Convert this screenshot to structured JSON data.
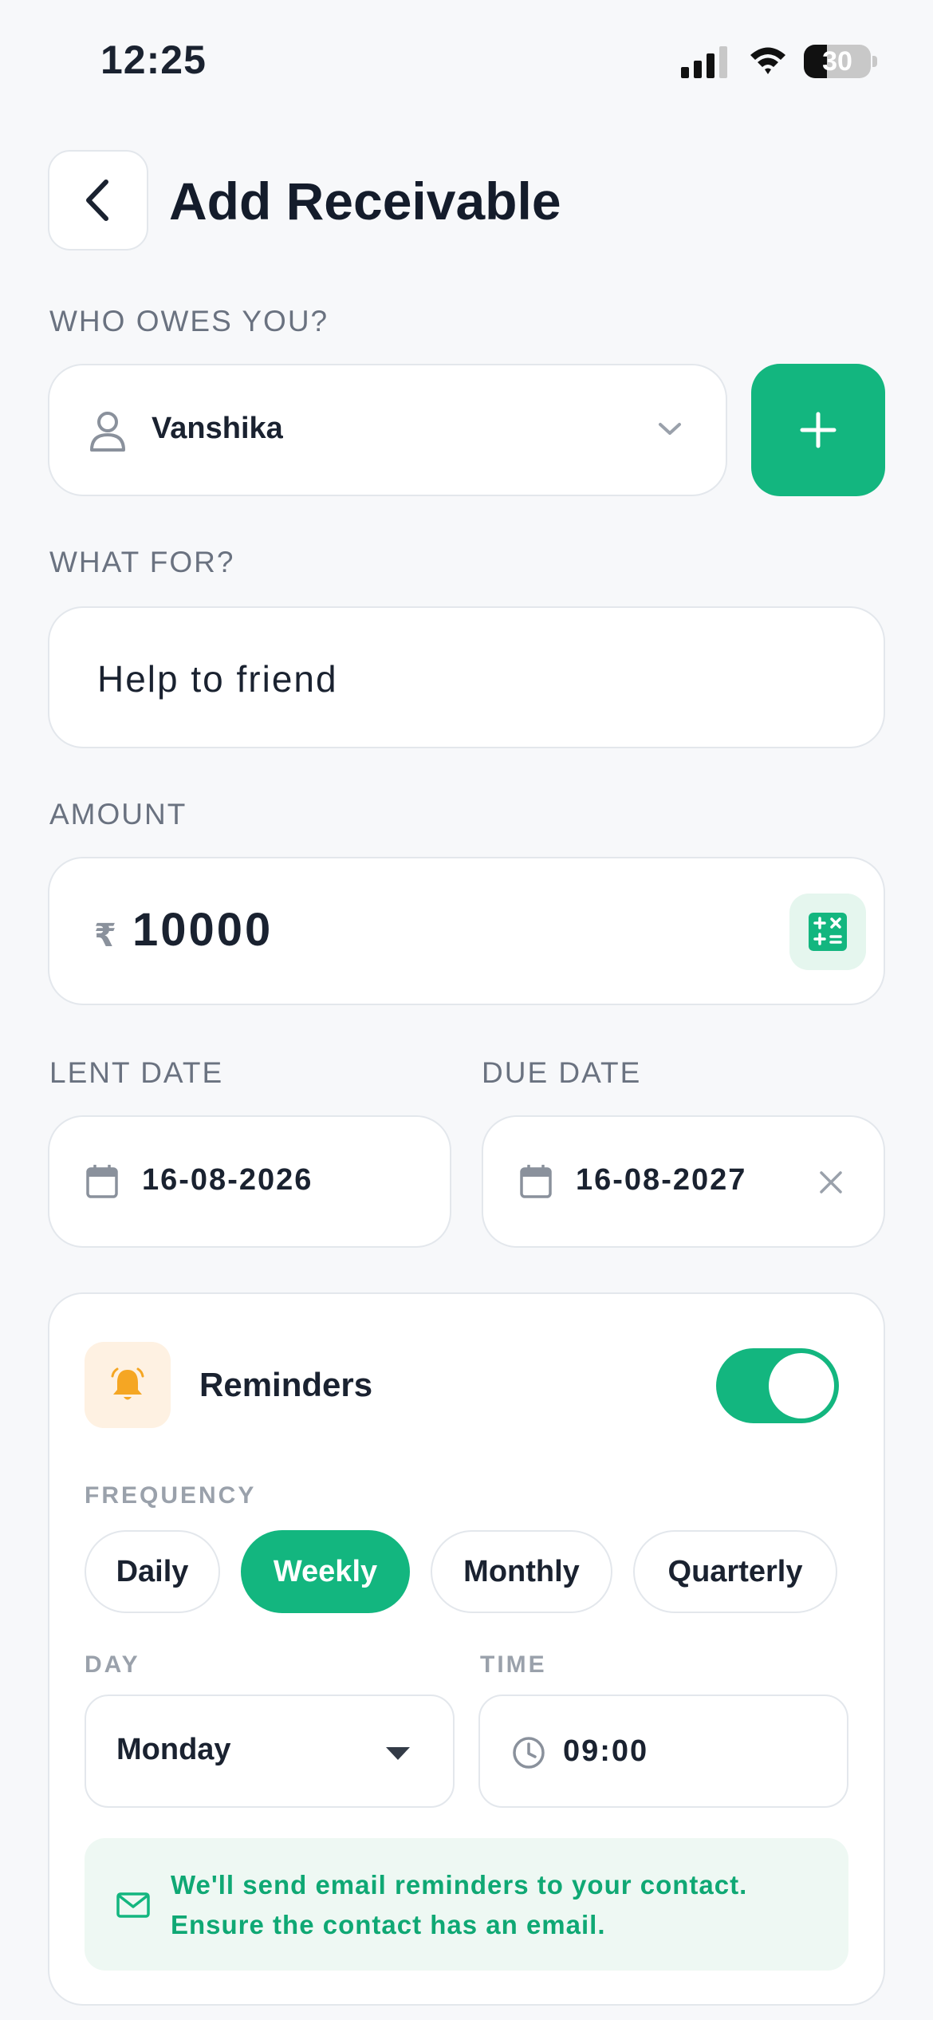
{
  "status_bar": {
    "time": "12:25",
    "battery": "30"
  },
  "header": {
    "title": "Add Receivable"
  },
  "who": {
    "label": "WHO OWES YOU?",
    "value": "Vanshika"
  },
  "what": {
    "label": "WHAT FOR?",
    "value": "Help to friend"
  },
  "amount": {
    "label": "AMOUNT",
    "currency": "₹",
    "value": "10000"
  },
  "lent_date": {
    "label": "LENT DATE",
    "value": "16-08-2026"
  },
  "due_date": {
    "label": "DUE DATE",
    "value": "16-08-2027"
  },
  "reminders": {
    "title": "Reminders",
    "enabled": true,
    "frequency_label": "FREQUENCY",
    "frequencies": [
      "Daily",
      "Weekly",
      "Monthly",
      "Quarterly"
    ],
    "selected_frequency": "Weekly",
    "day_label": "DAY",
    "day_value": "Monday",
    "time_label": "TIME",
    "time_value": "09:00",
    "info_line1": "We'll send email reminders to your contact.",
    "info_line2": "Ensure the contact has an email."
  },
  "colors": {
    "accent": "#13b67f",
    "bell_bg": "#fef1e2",
    "bell": "#f5a623",
    "info_bg": "#eef8f3"
  }
}
